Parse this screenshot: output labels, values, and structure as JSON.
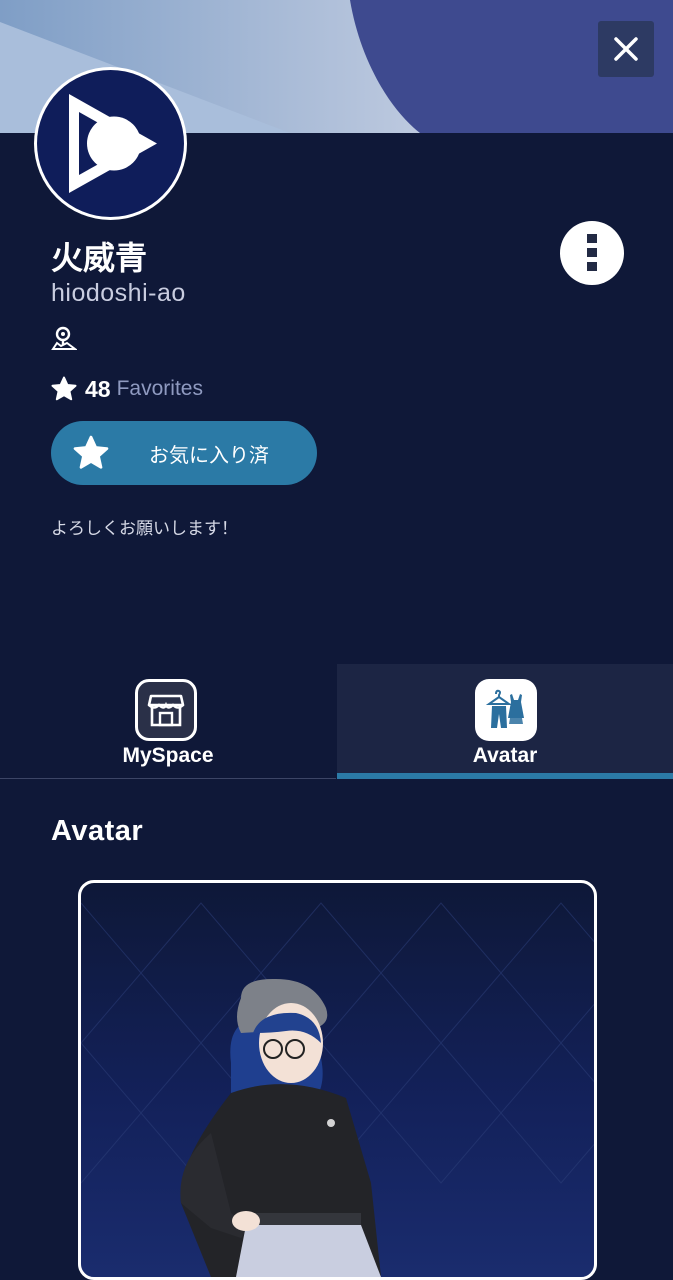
{
  "profile": {
    "display_name": "火威青",
    "username": "hiodoshi-ao",
    "favorites_count": "48",
    "favorites_label": "Favorites",
    "favorite_button_label": "お気に入り済",
    "bio": "よろしくお願いします！"
  },
  "tabs": [
    {
      "label": "MySpace",
      "icon": "storefront-icon",
      "active": false
    },
    {
      "label": "Avatar",
      "icon": "clothing-icon",
      "active": true
    }
  ],
  "section": {
    "title": "Avatar"
  },
  "colors": {
    "background": "#0f1838",
    "accent": "#2b7aa6",
    "banner": "#3e4a8f"
  },
  "icons": {
    "close": "close-icon",
    "more": "more-vertical-icon",
    "location": "location-icon",
    "star": "star-icon"
  }
}
